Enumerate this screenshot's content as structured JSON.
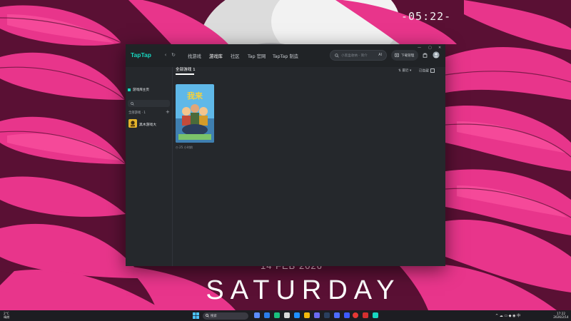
{
  "desktop": {
    "clock": "-05:22-",
    "date": "14 FEB 2026",
    "day": "SATURDAY"
  },
  "app": {
    "logo": "TapTap",
    "nav": [
      "找游戏",
      "游戏库",
      "社区",
      "Tap 官网",
      "TapTap 制造"
    ],
    "active_nav_index": 1,
    "search_placeholder": "小黑盒收纳 - 简介",
    "search_ai": "AI",
    "download_label": "下载管理",
    "sidebar": {
      "home_label": "游戏库主页",
      "all_games_label": "全部游戏 · 1",
      "game_name": "黑木游戏大"
    },
    "main": {
      "tab_label": "全部游戏 1",
      "sort_label": "最近 ▾",
      "hidden_label": "已隐藏",
      "card_title": "我来",
      "card_meta": "◷ 25 小时前"
    }
  },
  "taskbar": {
    "weather_line1": "2°C",
    "weather_line2": "晴朗",
    "search_placeholder": "搜索",
    "time": "17:22",
    "date": "2026/2/14",
    "tray_text": "^  ☁  ▭  ◆  ◉ 中"
  },
  "colors": {
    "accent": "#17d7c0",
    "window_bg": "#25282c",
    "wallpaper_pink": "#e8358b"
  }
}
